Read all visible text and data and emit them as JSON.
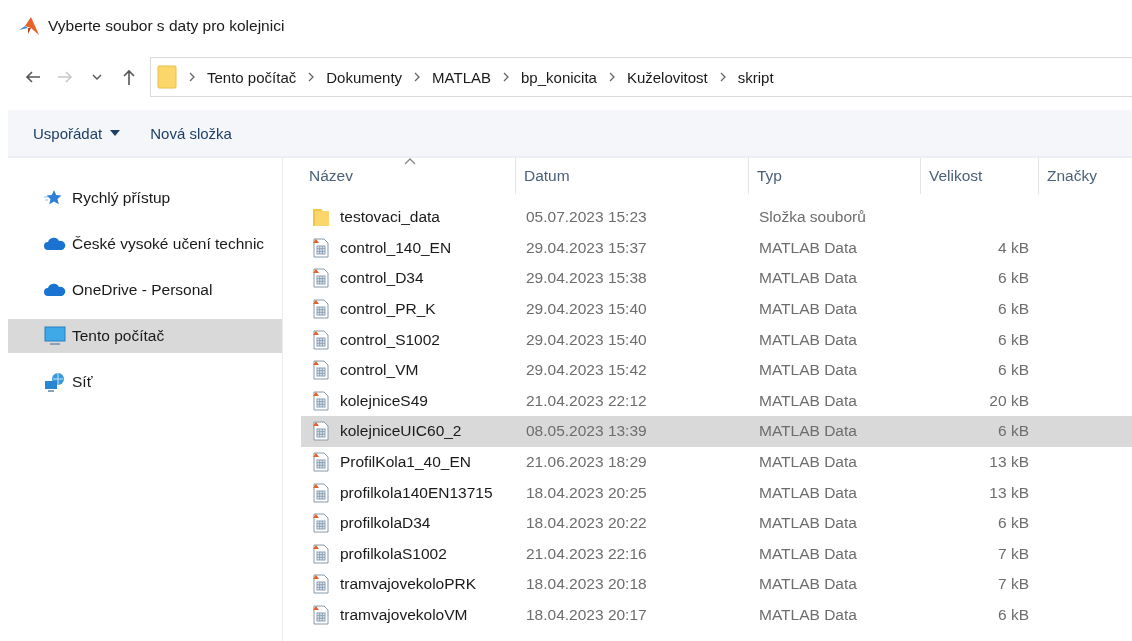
{
  "window": {
    "title": "Vyberte soubor s daty pro kolejnici"
  },
  "nav": {
    "buttons": [
      {
        "kind": "back",
        "disabled": false
      },
      {
        "kind": "forward",
        "disabled": true
      },
      {
        "kind": "recent",
        "disabled": false
      },
      {
        "kind": "up",
        "disabled": false
      }
    ],
    "path": [
      "Tento počítač",
      "Dokumenty",
      "MATLAB",
      "bp_konicita",
      "Kuželovitost",
      "skript"
    ]
  },
  "toolbar": {
    "items": [
      {
        "label": "Uspořádat",
        "kind": "menu"
      },
      {
        "label": "Nová složka",
        "kind": "button"
      }
    ]
  },
  "sidebar": {
    "items": [
      {
        "label": "Rychlý přístup",
        "kind": "star",
        "selected": false
      },
      {
        "label": "České vysoké učení technic",
        "kind": "cloud",
        "selected": false
      },
      {
        "label": "OneDrive - Personal",
        "kind": "cloud",
        "selected": false
      },
      {
        "label": "Tento počítač",
        "kind": "computer",
        "selected": true
      },
      {
        "label": "Síť",
        "kind": "network",
        "selected": false
      }
    ]
  },
  "files": {
    "columns": [
      {
        "label": "Název",
        "sorted": true
      },
      {
        "label": "Datum",
        "sorted": false
      },
      {
        "label": "Typ",
        "sorted": false
      },
      {
        "label": "Velikost",
        "sorted": false
      },
      {
        "label": "Značky",
        "sorted": false
      }
    ],
    "rows": [
      {
        "kind": "folder",
        "name": "testovaci_data",
        "date": "05.07.2023 15:23",
        "type": "Složka souborů",
        "selected": false
      },
      {
        "kind": "matfile",
        "name": "control_140_EN",
        "date": "29.04.2023 15:37",
        "type": "MATLAB Data",
        "size": "4 kB",
        "selected": false
      },
      {
        "kind": "matfile",
        "name": "control_D34",
        "date": "29.04.2023 15:38",
        "type": "MATLAB Data",
        "size": "6 kB",
        "selected": false
      },
      {
        "kind": "matfile",
        "name": "control_PR_K",
        "date": "29.04.2023 15:40",
        "type": "MATLAB Data",
        "size": "6 kB",
        "selected": false
      },
      {
        "kind": "matfile",
        "name": "control_S1002",
        "date": "29.04.2023 15:40",
        "type": "MATLAB Data",
        "size": "6 kB",
        "selected": false
      },
      {
        "kind": "matfile",
        "name": "control_VM",
        "date": "29.04.2023 15:42",
        "type": "MATLAB Data",
        "size": "6 kB",
        "selected": false
      },
      {
        "kind": "matfile",
        "name": "kolejniceS49",
        "date": "21.04.2023 22:12",
        "type": "MATLAB Data",
        "size": "20 kB",
        "selected": false
      },
      {
        "kind": "matfile",
        "name": "kolejniceUIC60_2",
        "date": "08.05.2023 13:39",
        "type": "MATLAB Data",
        "size": "6 kB",
        "selected": true
      },
      {
        "kind": "matfile",
        "name": "ProfilKola1_40_EN",
        "date": "21.06.2023 18:29",
        "type": "MATLAB Data",
        "size": "13 kB",
        "selected": false
      },
      {
        "kind": "matfile",
        "name": "profilkola140EN13715",
        "date": "18.04.2023 20:25",
        "type": "MATLAB Data",
        "size": "13 kB",
        "selected": false
      },
      {
        "kind": "matfile",
        "name": "profilkolaD34",
        "date": "18.04.2023 20:22",
        "type": "MATLAB Data",
        "size": "6 kB",
        "selected": false
      },
      {
        "kind": "matfile",
        "name": "profilkolaS1002",
        "date": "21.04.2023 22:16",
        "type": "MATLAB Data",
        "size": "7 kB",
        "selected": false
      },
      {
        "kind": "matfile",
        "name": "tramvajovekoloPRK",
        "date": "18.04.2023 20:18",
        "type": "MATLAB Data",
        "size": "7 kB",
        "selected": false
      },
      {
        "kind": "matfile",
        "name": "tramvajovekoloVM",
        "date": "18.04.2023 20:17",
        "type": "MATLAB Data",
        "size": "6 kB",
        "selected": false
      }
    ]
  }
}
